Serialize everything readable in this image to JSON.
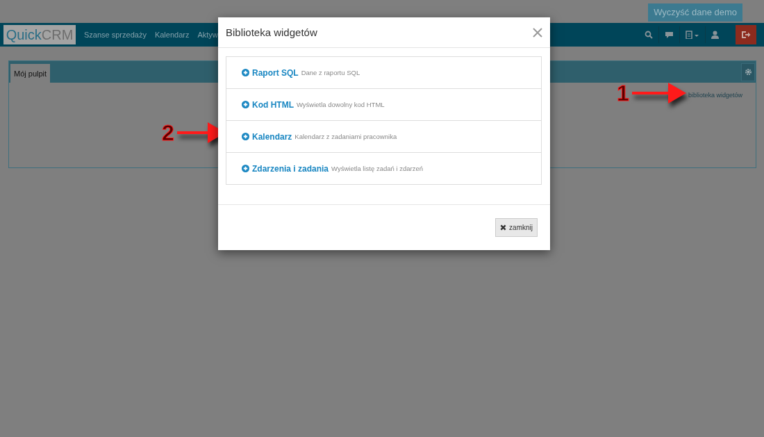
{
  "top_button": "Wyczyść dane demo",
  "navbar": {
    "logo": {
      "part1": "Quick",
      "part2": "CRM"
    },
    "items": [
      "Szanse sprzedaży",
      "Kalendarz",
      "Aktyw"
    ]
  },
  "dashboard": {
    "tabs": [
      {
        "label": "Mój pulpit",
        "selected": true
      }
    ],
    "widget_library_link": "biblioteka widgetów"
  },
  "modal": {
    "title": "Biblioteka widgetów",
    "widgets": [
      {
        "name": "Raport SQL",
        "description": "Dane z raportu SQL"
      },
      {
        "name": "Kod HTML",
        "description": "Wyświetla dowolny kod HTML"
      },
      {
        "name": "Kalendarz",
        "description": "Kalendarz z zadaniami pracownika"
      },
      {
        "name": "Zdarzenia i zadania",
        "description": "Wyświetla listę zadań i zdarzeń"
      }
    ],
    "close_button": "zamknij"
  },
  "annotations": [
    {
      "number": "1"
    },
    {
      "number": "2"
    }
  ]
}
